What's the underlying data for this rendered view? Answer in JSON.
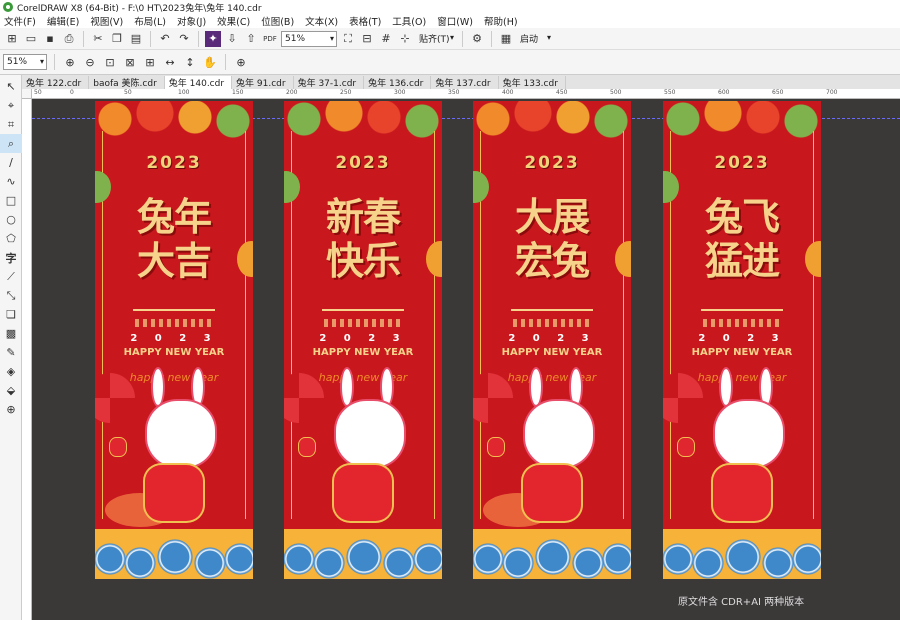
{
  "app": {
    "title": "CorelDRAW X8 (64-Bit) - F:\\0 HT\\2023兔年\\兔年 140.cdr"
  },
  "menu": [
    "文件(F)",
    "编辑(E)",
    "视图(V)",
    "布局(L)",
    "对象(J)",
    "效果(C)",
    "位图(B)",
    "文本(X)",
    "表格(T)",
    "工具(O)",
    "窗口(W)",
    "帮助(H)"
  ],
  "toolbar": {
    "zoom": "51%",
    "snap_label": "贴齐(T)",
    "launch_label": "启动"
  },
  "propbar": {
    "zoom": "51%"
  },
  "tabs": [
    "兔年 122.cdr",
    "baofa 美陈.cdr",
    "兔年 140.cdr",
    "兔年 91.cdr",
    "兔年 37-1.cdr",
    "兔年 136.cdr",
    "兔年 137.cdr",
    "兔年 133.cdr"
  ],
  "ruler_labels": [
    "50",
    "0",
    "50",
    "100",
    "150",
    "200",
    "250",
    "300",
    "350",
    "400",
    "450",
    "500",
    "550",
    "600",
    "650",
    "700"
  ],
  "banners": [
    {
      "line1": "兔年",
      "line2": "大吉",
      "year": "2023",
      "year_spaced": "2 0 2 3",
      "greeting": "HAPPY NEW YEAR",
      "script": "happy new year"
    },
    {
      "line1": "新春",
      "line2": "快乐",
      "year": "2023",
      "year_spaced": "2 0 2 3",
      "greeting": "HAPPY NEW YEAR",
      "script": "happy new year"
    },
    {
      "line1": "大展",
      "line2": "宏兔",
      "year": "2023",
      "year_spaced": "2 0 2 3",
      "greeting": "HAPPY NEW YEAR",
      "script": "happy new year"
    },
    {
      "line1": "兔飞",
      "line2": "猛进",
      "year": "2023",
      "year_spaced": "2 0 2 3",
      "greeting": "HAPPY NEW YEAR",
      "script": "happy new year"
    }
  ],
  "watermark": "原文件含 CDR+AI 两种版本",
  "colors": {
    "banner_red": "#c8171d",
    "gold": "#f6d28a",
    "canvas_bg": "#3b3838",
    "wave_blue": "#3f88c9"
  }
}
